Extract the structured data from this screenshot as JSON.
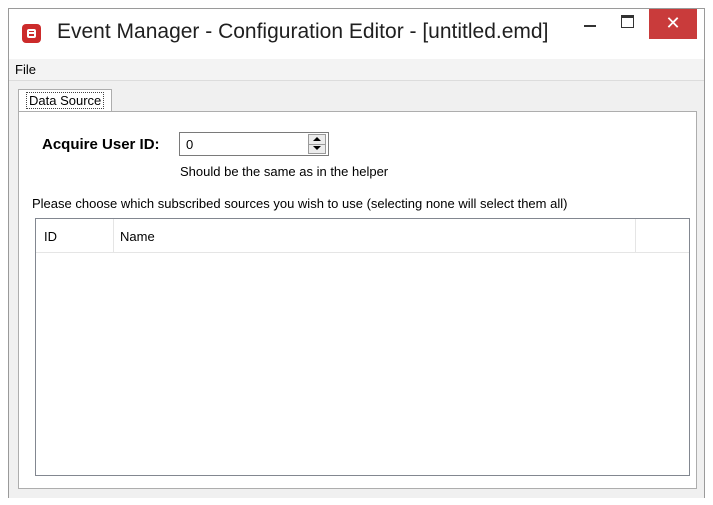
{
  "window": {
    "title": "Event Manager - Configuration Editor -  [untitled.emd]",
    "app_icon": "event-manager-logo",
    "close_glyph": "✕"
  },
  "menu": {
    "file": "File"
  },
  "tabs": [
    {
      "label": "Data Source",
      "selected": true
    }
  ],
  "form": {
    "acquire_label": "Acquire User ID:",
    "acquire_value": "0",
    "hint": "Should be the same as in the helper",
    "instruction": "Please choose which subscribed sources you wish to use (selecting none will select them all)"
  },
  "list": {
    "columns": [
      "ID",
      "Name"
    ],
    "rows": []
  },
  "colors": {
    "close_button": "#c93b3b",
    "app_icon": "#cc2b2b"
  }
}
